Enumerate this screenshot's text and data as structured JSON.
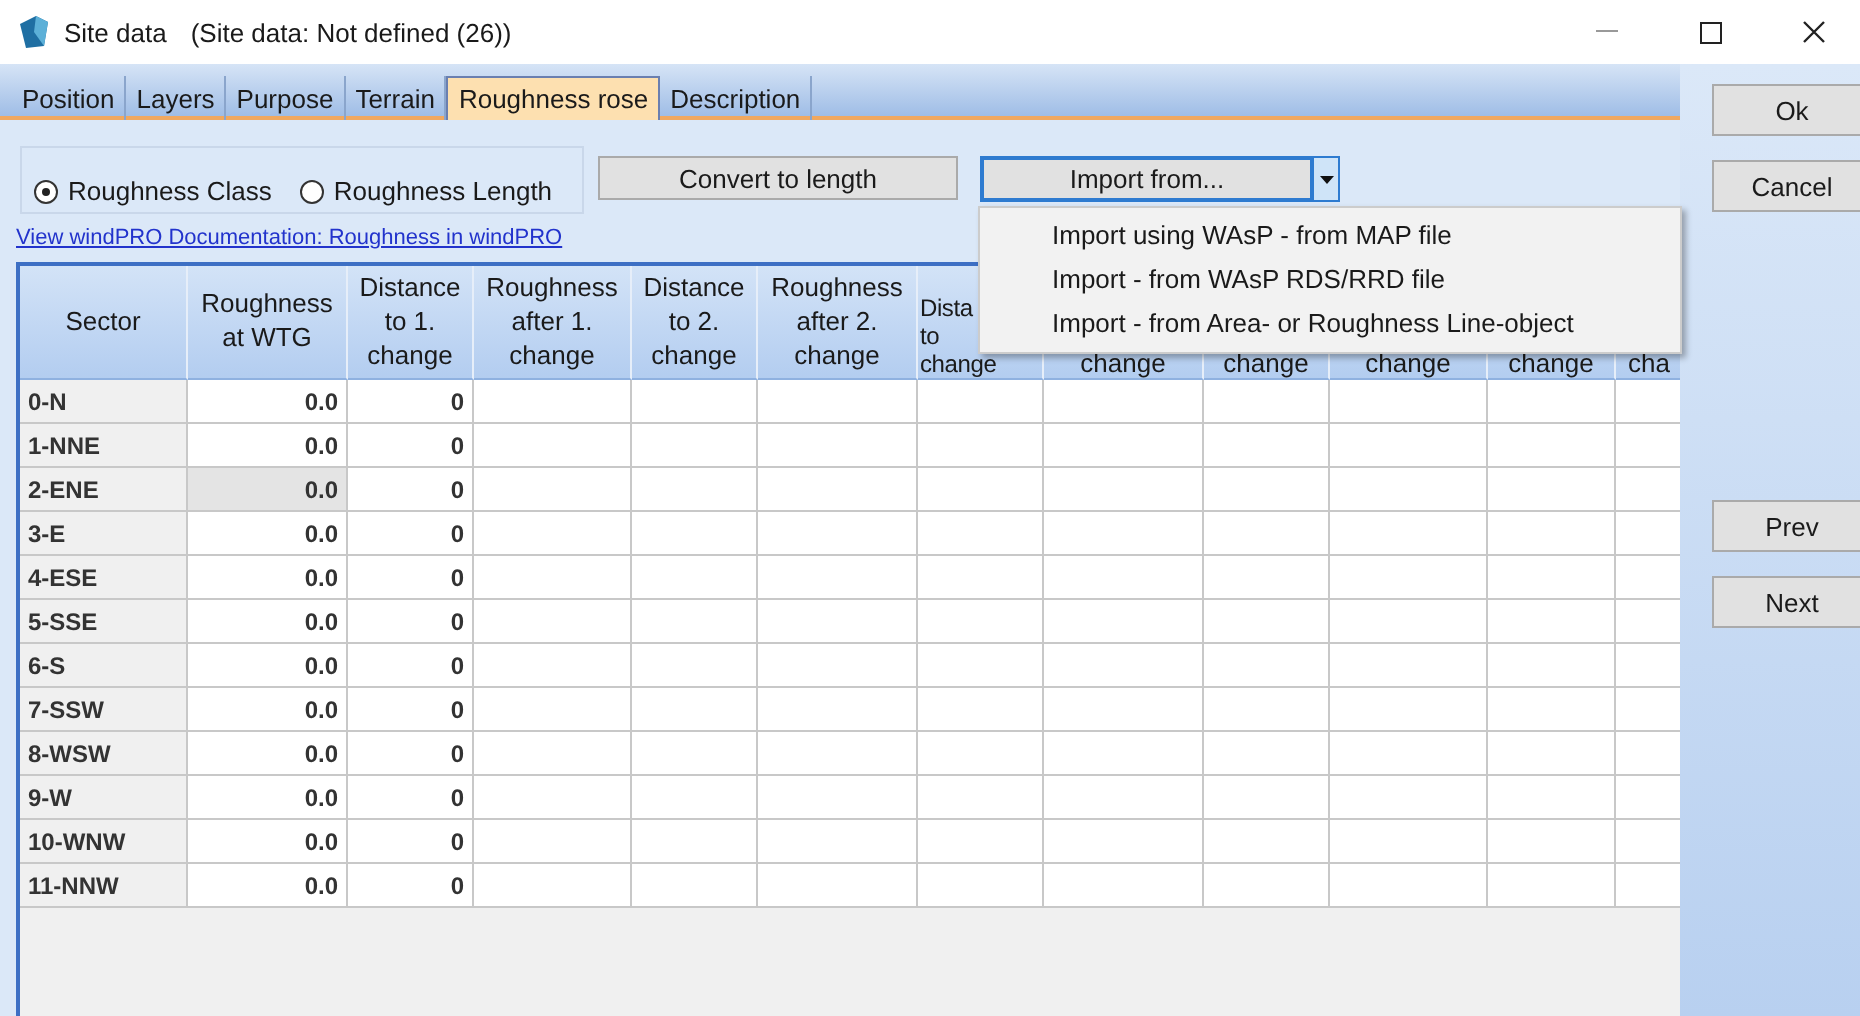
{
  "window": {
    "title": "Site data",
    "subtitle": "(Site data: Not defined (26))"
  },
  "tabs": [
    {
      "label": "Position",
      "selected": false
    },
    {
      "label": "Layers",
      "selected": false
    },
    {
      "label": "Purpose",
      "selected": false
    },
    {
      "label": "Terrain",
      "selected": false
    },
    {
      "label": "Roughness rose",
      "selected": true
    },
    {
      "label": "Description",
      "selected": false
    }
  ],
  "mode_radios": [
    {
      "label": "Roughness Class",
      "selected": true
    },
    {
      "label": "Roughness Length",
      "selected": false
    }
  ],
  "convert_button": "Convert to length",
  "import_button": {
    "label": "Import from...",
    "expanded": true
  },
  "import_menu": [
    "Import using WAsP - from MAP file",
    "Import - from WAsP RDS/RRD file",
    "Import - from Area- or Roughness Line-object"
  ],
  "doc_link": "View windPRO Documentation: Roughness in windPRO",
  "table": {
    "columns": [
      {
        "label": "Sector",
        "kind": "full"
      },
      {
        "label": "Roughness\nat WTG",
        "kind": "full"
      },
      {
        "label": "Distance\nto 1.\nchange",
        "kind": "full"
      },
      {
        "label": "Roughness\nafter 1.\nchange",
        "kind": "full"
      },
      {
        "label": "Distance\nto 2.\nchange",
        "kind": "full"
      },
      {
        "label": "Roughness\nafter 2.\nchange",
        "kind": "full"
      },
      {
        "label": "Dista\nto\nchange",
        "kind": "clipped"
      },
      {
        "label": "change",
        "kind": "partial"
      },
      {
        "label": "change",
        "kind": "partial"
      },
      {
        "label": "change",
        "kind": "partial"
      },
      {
        "label": "change",
        "kind": "partial"
      },
      {
        "label": "cha",
        "kind": "partial"
      }
    ],
    "rows": [
      {
        "sector": "0-N",
        "roughness": "0.0",
        "distance": "0",
        "selected": false
      },
      {
        "sector": "1-NNE",
        "roughness": "0.0",
        "distance": "0",
        "selected": false
      },
      {
        "sector": "2-ENE",
        "roughness": "0.0",
        "distance": "0",
        "selected": true
      },
      {
        "sector": "3-E",
        "roughness": "0.0",
        "distance": "0",
        "selected": false
      },
      {
        "sector": "4-ESE",
        "roughness": "0.0",
        "distance": "0",
        "selected": false
      },
      {
        "sector": "5-SSE",
        "roughness": "0.0",
        "distance": "0",
        "selected": false
      },
      {
        "sector": "6-S",
        "roughness": "0.0",
        "distance": "0",
        "selected": false
      },
      {
        "sector": "7-SSW",
        "roughness": "0.0",
        "distance": "0",
        "selected": false
      },
      {
        "sector": "8-WSW",
        "roughness": "0.0",
        "distance": "0",
        "selected": false
      },
      {
        "sector": "9-W",
        "roughness": "0.0",
        "distance": "0",
        "selected": false
      },
      {
        "sector": "10-WNW",
        "roughness": "0.0",
        "distance": "0",
        "selected": false
      },
      {
        "sector": "11-NNW",
        "roughness": "0.0",
        "distance": "0",
        "selected": false
      }
    ]
  },
  "side_buttons": [
    {
      "label": "Ok",
      "kind": "top"
    },
    {
      "label": "Cancel",
      "kind": "top"
    },
    {
      "label": "Prev",
      "kind": "bottom"
    },
    {
      "label": "Next",
      "kind": "bottom"
    }
  ]
}
